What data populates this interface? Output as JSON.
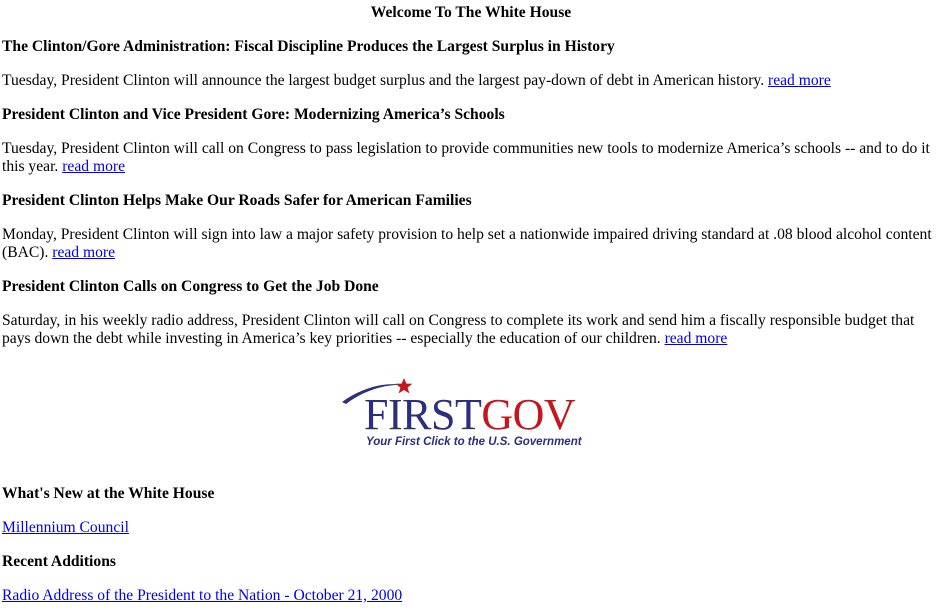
{
  "page": {
    "title": "Welcome To The White House"
  },
  "stories": [
    {
      "headline": "The Clinton/Gore Administration: Fiscal Discipline Produces the Largest Surplus in History",
      "summary": "Tuesday, President Clinton will announce the largest budget surplus and the largest pay-down of debt in American history.",
      "link": "read more"
    },
    {
      "headline": "President Clinton and Vice President Gore: Modernizing America’s Schools",
      "summary": "Tuesday, President Clinton will call on Congress to pass legislation to provide communities new tools to modernize America’s schools -- and to do it this year.",
      "link": "read more"
    },
    {
      "headline": "President Clinton Helps Make Our Roads Safer for American Families",
      "summary": "Monday, President Clinton will sign into law a major safety provision to help set a nationwide impaired driving standard at .08 blood alcohol content (BAC).",
      "link": "read more"
    },
    {
      "headline": "President Clinton Calls on Congress to Get the Job Done",
      "summary": "Saturday, in his weekly radio address, President Clinton will call on Congress to complete its work and send him a fiscally responsible budget that pays down the debt while investing in America’s key priorities -- especially the education of our children.",
      "link": "read more"
    }
  ],
  "logo": {
    "word_first": "FIRST",
    "word_gov": "GOV",
    "tagline": "Your First Click to the U.S. Government",
    "colors": {
      "first": "#2b2f7e",
      "gov": "#c4161c",
      "star": "#c4161c",
      "swoosh": "#2b2f7e"
    }
  },
  "whats_new": {
    "heading": "What's New at the White House",
    "link": "Millennium Council"
  },
  "recent": {
    "heading": "Recent Additions",
    "link": "Radio Address of the President to the Nation - October 21, 2000"
  },
  "colors": {
    "link": "#0000ee",
    "text": "#000000",
    "background": "#ffffff"
  }
}
